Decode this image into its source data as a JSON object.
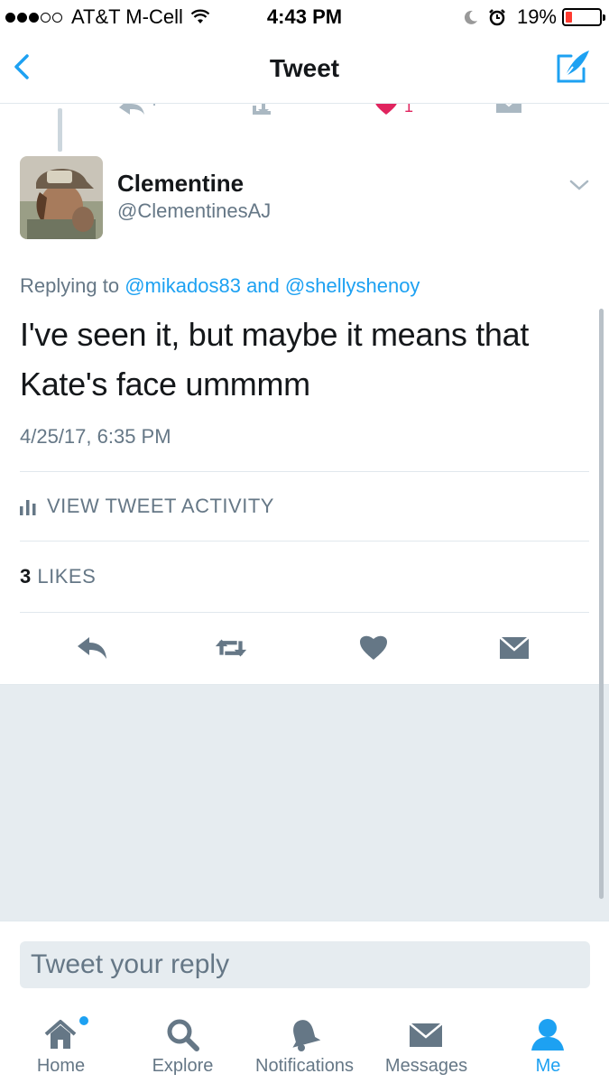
{
  "status_bar": {
    "carrier": "AT&T M-Cell",
    "time": "4:43 PM",
    "battery_percent": "19%",
    "battery_level": 0.19
  },
  "nav": {
    "title": "Tweet"
  },
  "tweet": {
    "display_name": "Clementine",
    "handle": "@ClementinesAJ",
    "replying_prefix": "Replying to",
    "reply_user_1": "@mikados83",
    "reply_and": "and",
    "reply_user_2": "@shellyshenoy",
    "text": "I've seen it, but maybe it means that Kate's face ummmm",
    "timestamp": "4/25/17, 6:35 PM",
    "activity_label": "VIEW TWEET ACTIVITY",
    "likes_count": "3",
    "likes_label": "LIKES",
    "previous_tweet_likes": "1"
  },
  "reply": {
    "placeholder": "Tweet your reply"
  },
  "tabs": [
    {
      "label": "Home",
      "icon": "home-icon"
    },
    {
      "label": "Explore",
      "icon": "search-icon"
    },
    {
      "label": "Notifications",
      "icon": "bell-icon"
    },
    {
      "label": "Messages",
      "icon": "envelope-icon"
    },
    {
      "label": "Me",
      "icon": "person-icon"
    }
  ],
  "colors": {
    "accent": "#1da1f2",
    "secondary_text": "#657786",
    "like_red": "#e0245e",
    "background_gray": "#e6ecf0"
  }
}
